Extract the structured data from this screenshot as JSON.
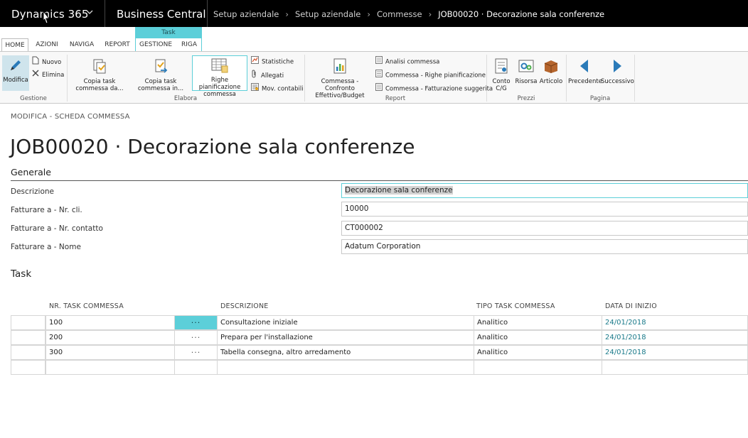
{
  "topbar": {
    "app_name": "Dynamics 365",
    "product": "Business Central",
    "breadcrumbs": [
      "Setup aziendale",
      "Setup aziendale",
      "Commesse",
      "JOB00020 · Decorazione sala conferenze"
    ]
  },
  "ribbon": {
    "context_tab_label": "Task",
    "tabs": [
      "HOME",
      "AZIONI",
      "NAVIGA",
      "REPORT",
      "GESTIONE",
      "RIGA"
    ],
    "active_tab": "HOME",
    "groups": {
      "gestione": {
        "label": "Gestione",
        "modifica": "Modifica",
        "nuovo": "Nuovo",
        "elimina": "Elimina"
      },
      "elabora": {
        "label": "Elabora",
        "copia_task_da": "Copia task commessa da...",
        "copia_task_in": "Copia task commessa in...",
        "righe_pianificazione": "Righe pianificazione commessa",
        "statistiche": "Statistiche",
        "allegati": "Allegati",
        "mov_contabili": "Mov. contabili"
      },
      "report": {
        "label": "Report",
        "confronto": "Commessa - Confronto Effettivo/Budget",
        "analisi": "Analisi commessa",
        "righe_pian": "Commessa - Righe pianificazione",
        "fatturazione": "Commessa - Fatturazione suggerita"
      },
      "prezzi": {
        "label": "Prezzi",
        "conto": "Conto C/G",
        "risorsa": "Risorsa",
        "articolo": "Articolo"
      },
      "pagina": {
        "label": "Pagina",
        "precedente": "Precedente",
        "successivo": "Successivo"
      }
    }
  },
  "page": {
    "caption": "MODIFICA - SCHEDA COMMESSA",
    "title": "JOB00020 · Decorazione sala conferenze"
  },
  "generale": {
    "heading": "Generale",
    "fields": [
      {
        "label": "Descrizione",
        "value": "Decorazione sala conferenze"
      },
      {
        "label": "Fatturare a - Nr. cli.",
        "value": "10000"
      },
      {
        "label": "Fatturare a - Nr. contatto",
        "value": "CT000002"
      },
      {
        "label": "Fatturare a - Nome",
        "value": "Adatum Corporation"
      }
    ]
  },
  "task": {
    "heading": "Task",
    "columns": [
      "NR. TASK COMMESSA",
      "DESCRIZIONE",
      "TIPO TASK COMMESSA",
      "DATA DI INIZIO"
    ],
    "rows": [
      {
        "nr": "100",
        "dots": "···",
        "descrizione": "Consultazione iniziale",
        "tipo": "Analitico",
        "data": "24/01/2018"
      },
      {
        "nr": "200",
        "dots": "···",
        "descrizione": "Prepara per l'installazione",
        "tipo": "Analitico",
        "data": "24/01/2018"
      },
      {
        "nr": "300",
        "dots": "···",
        "descrizione": "Tabella consegna, altro arredamento",
        "tipo": "Analitico",
        "data": "24/01/2018"
      },
      {
        "nr": "",
        "dots": "",
        "descrizione": "",
        "tipo": "",
        "data": ""
      }
    ]
  },
  "colors": {
    "accent": "#5ccfd9",
    "topbar": "#000000",
    "date_link": "#197a8a"
  }
}
